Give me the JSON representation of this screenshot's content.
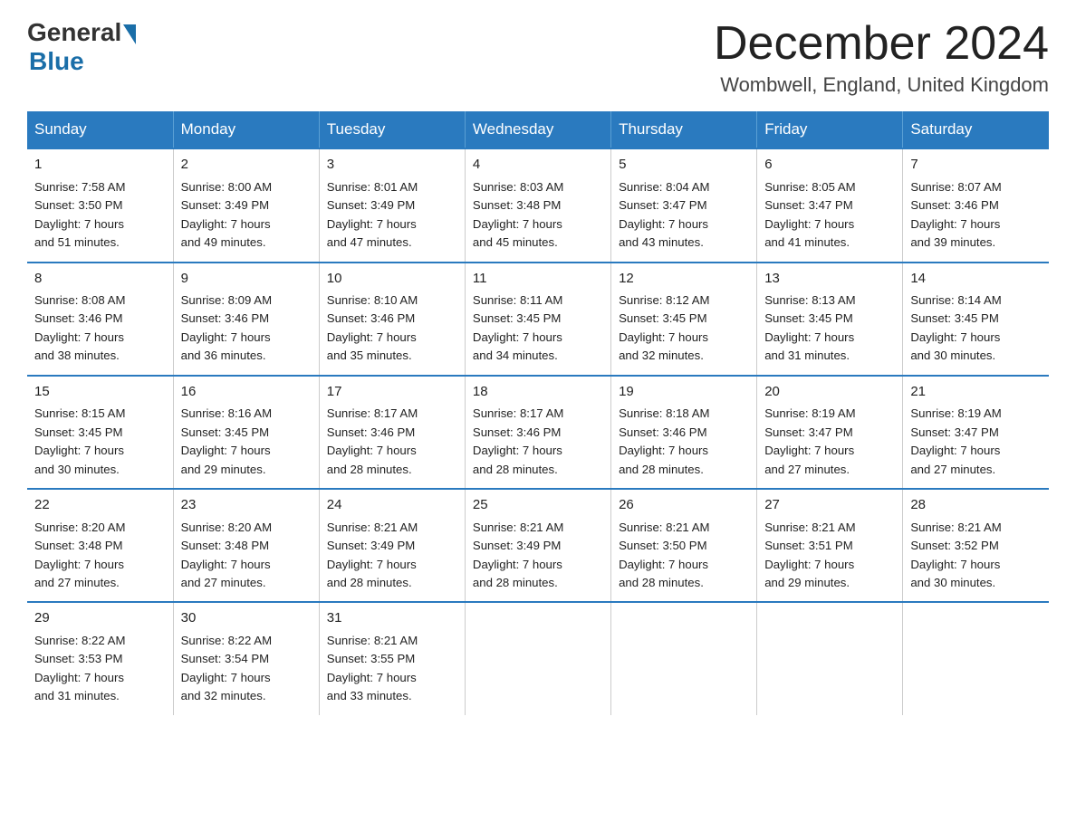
{
  "logo": {
    "general": "General",
    "blue": "Blue"
  },
  "title": "December 2024",
  "subtitle": "Wombwell, England, United Kingdom",
  "days_header": [
    "Sunday",
    "Monday",
    "Tuesday",
    "Wednesday",
    "Thursday",
    "Friday",
    "Saturday"
  ],
  "weeks": [
    [
      {
        "num": "1",
        "info": "Sunrise: 7:58 AM\nSunset: 3:50 PM\nDaylight: 7 hours\nand 51 minutes."
      },
      {
        "num": "2",
        "info": "Sunrise: 8:00 AM\nSunset: 3:49 PM\nDaylight: 7 hours\nand 49 minutes."
      },
      {
        "num": "3",
        "info": "Sunrise: 8:01 AM\nSunset: 3:49 PM\nDaylight: 7 hours\nand 47 minutes."
      },
      {
        "num": "4",
        "info": "Sunrise: 8:03 AM\nSunset: 3:48 PM\nDaylight: 7 hours\nand 45 minutes."
      },
      {
        "num": "5",
        "info": "Sunrise: 8:04 AM\nSunset: 3:47 PM\nDaylight: 7 hours\nand 43 minutes."
      },
      {
        "num": "6",
        "info": "Sunrise: 8:05 AM\nSunset: 3:47 PM\nDaylight: 7 hours\nand 41 minutes."
      },
      {
        "num": "7",
        "info": "Sunrise: 8:07 AM\nSunset: 3:46 PM\nDaylight: 7 hours\nand 39 minutes."
      }
    ],
    [
      {
        "num": "8",
        "info": "Sunrise: 8:08 AM\nSunset: 3:46 PM\nDaylight: 7 hours\nand 38 minutes."
      },
      {
        "num": "9",
        "info": "Sunrise: 8:09 AM\nSunset: 3:46 PM\nDaylight: 7 hours\nand 36 minutes."
      },
      {
        "num": "10",
        "info": "Sunrise: 8:10 AM\nSunset: 3:46 PM\nDaylight: 7 hours\nand 35 minutes."
      },
      {
        "num": "11",
        "info": "Sunrise: 8:11 AM\nSunset: 3:45 PM\nDaylight: 7 hours\nand 34 minutes."
      },
      {
        "num": "12",
        "info": "Sunrise: 8:12 AM\nSunset: 3:45 PM\nDaylight: 7 hours\nand 32 minutes."
      },
      {
        "num": "13",
        "info": "Sunrise: 8:13 AM\nSunset: 3:45 PM\nDaylight: 7 hours\nand 31 minutes."
      },
      {
        "num": "14",
        "info": "Sunrise: 8:14 AM\nSunset: 3:45 PM\nDaylight: 7 hours\nand 30 minutes."
      }
    ],
    [
      {
        "num": "15",
        "info": "Sunrise: 8:15 AM\nSunset: 3:45 PM\nDaylight: 7 hours\nand 30 minutes."
      },
      {
        "num": "16",
        "info": "Sunrise: 8:16 AM\nSunset: 3:45 PM\nDaylight: 7 hours\nand 29 minutes."
      },
      {
        "num": "17",
        "info": "Sunrise: 8:17 AM\nSunset: 3:46 PM\nDaylight: 7 hours\nand 28 minutes."
      },
      {
        "num": "18",
        "info": "Sunrise: 8:17 AM\nSunset: 3:46 PM\nDaylight: 7 hours\nand 28 minutes."
      },
      {
        "num": "19",
        "info": "Sunrise: 8:18 AM\nSunset: 3:46 PM\nDaylight: 7 hours\nand 28 minutes."
      },
      {
        "num": "20",
        "info": "Sunrise: 8:19 AM\nSunset: 3:47 PM\nDaylight: 7 hours\nand 27 minutes."
      },
      {
        "num": "21",
        "info": "Sunrise: 8:19 AM\nSunset: 3:47 PM\nDaylight: 7 hours\nand 27 minutes."
      }
    ],
    [
      {
        "num": "22",
        "info": "Sunrise: 8:20 AM\nSunset: 3:48 PM\nDaylight: 7 hours\nand 27 minutes."
      },
      {
        "num": "23",
        "info": "Sunrise: 8:20 AM\nSunset: 3:48 PM\nDaylight: 7 hours\nand 27 minutes."
      },
      {
        "num": "24",
        "info": "Sunrise: 8:21 AM\nSunset: 3:49 PM\nDaylight: 7 hours\nand 28 minutes."
      },
      {
        "num": "25",
        "info": "Sunrise: 8:21 AM\nSunset: 3:49 PM\nDaylight: 7 hours\nand 28 minutes."
      },
      {
        "num": "26",
        "info": "Sunrise: 8:21 AM\nSunset: 3:50 PM\nDaylight: 7 hours\nand 28 minutes."
      },
      {
        "num": "27",
        "info": "Sunrise: 8:21 AM\nSunset: 3:51 PM\nDaylight: 7 hours\nand 29 minutes."
      },
      {
        "num": "28",
        "info": "Sunrise: 8:21 AM\nSunset: 3:52 PM\nDaylight: 7 hours\nand 30 minutes."
      }
    ],
    [
      {
        "num": "29",
        "info": "Sunrise: 8:22 AM\nSunset: 3:53 PM\nDaylight: 7 hours\nand 31 minutes."
      },
      {
        "num": "30",
        "info": "Sunrise: 8:22 AM\nSunset: 3:54 PM\nDaylight: 7 hours\nand 32 minutes."
      },
      {
        "num": "31",
        "info": "Sunrise: 8:21 AM\nSunset: 3:55 PM\nDaylight: 7 hours\nand 33 minutes."
      },
      {
        "num": "",
        "info": ""
      },
      {
        "num": "",
        "info": ""
      },
      {
        "num": "",
        "info": ""
      },
      {
        "num": "",
        "info": ""
      }
    ]
  ]
}
